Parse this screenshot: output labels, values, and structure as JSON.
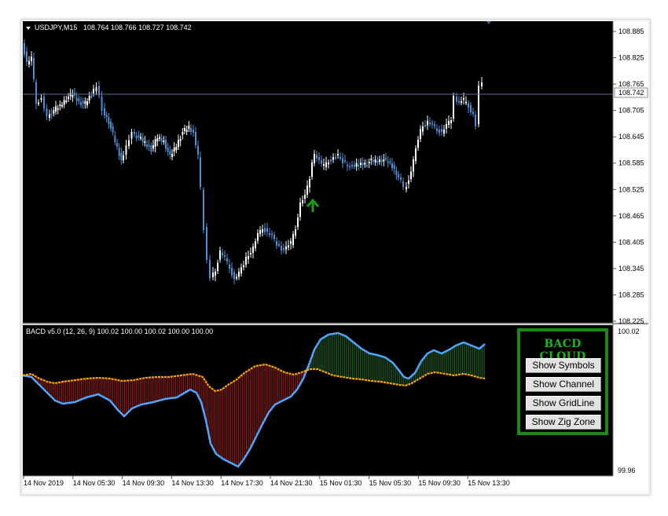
{
  "main_chart": {
    "symbol_header": "USDJPY,M15",
    "quote_values": "108.764 108.766 108.727 108.742",
    "price_axis_labels": [
      "108.885",
      "108.825",
      "108.765",
      "108.705",
      "108.645",
      "108.585",
      "108.525",
      "108.465",
      "108.405",
      "108.345",
      "108.285",
      "108.225"
    ],
    "current_price_label": "108.742",
    "price_range": [
      108.225,
      108.885
    ],
    "current_price": 108.742
  },
  "indicator": {
    "header": "BACD v5.0 (12, 26, 9) 100.02 100.00 100.02 100.00 100.00",
    "axis_top_label": "100.02",
    "axis_bottom_label": "99.96"
  },
  "time_axis_labels": [
    "14 Nov 2019",
    "14 Nov 05:30",
    "14 Nov 09:30",
    "14 Nov 13:30",
    "14 Nov 17:30",
    "14 Nov 21:30",
    "15 Nov 01:30",
    "15 Nov 05:30",
    "15 Nov 09:30",
    "15 Nov 13:30"
  ],
  "bacd_panel": {
    "title": "BACD CLOUD",
    "buttons": [
      "Show Symbols",
      "Show Channel",
      "Show GridLine",
      "Show Zig Zone"
    ]
  },
  "colors": {
    "background": "#000000",
    "bull_candle": "#ffffff",
    "bear_candle": "#4a90d9",
    "fast_line": "#4da6ff",
    "slow_line": "#ffa500",
    "bear_cloud": "#8b1a1a",
    "bull_cloud": "#1e5a1e",
    "panel_border": "#1b8a1b",
    "panel_title": "#1eb41e",
    "arrow": "#1a9c1a"
  }
}
